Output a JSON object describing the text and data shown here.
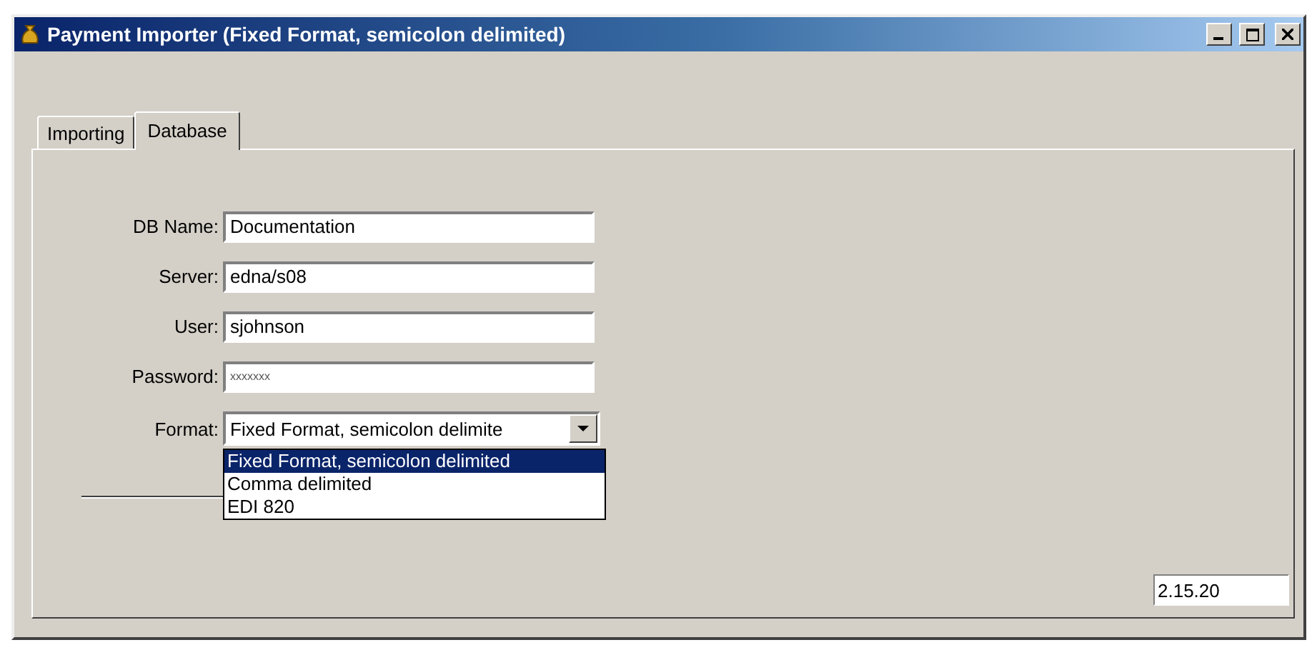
{
  "window": {
    "title": "Payment Importer (Fixed Format, semicolon delimited)"
  },
  "tabs": [
    {
      "label": "Importing",
      "selected": false
    },
    {
      "label": "Database",
      "selected": true
    }
  ],
  "fields": [
    {
      "label": "DB Name:",
      "value": "Documentation"
    },
    {
      "label": "Server:",
      "value": "edna/s08"
    },
    {
      "label": "User:",
      "value": "sjohnson"
    },
    {
      "label": "Password:",
      "value": "xxxxxxx"
    }
  ],
  "format": {
    "label": "Format:",
    "value": "Fixed Format, semicolon delimite",
    "expanded": true,
    "options": [
      {
        "label": "Fixed Format, semicolon delimited",
        "selected": true
      },
      {
        "label": "Comma delimited",
        "selected": false
      },
      {
        "label": "EDI 820",
        "selected": false
      }
    ]
  },
  "version": "2.15.20"
}
